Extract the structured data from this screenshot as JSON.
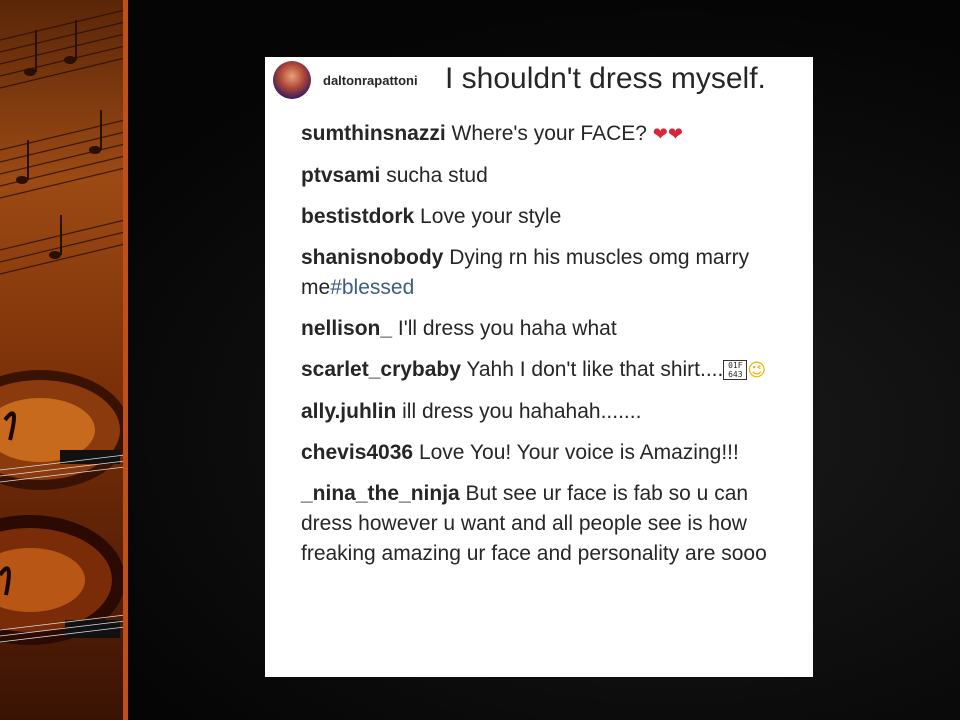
{
  "post": {
    "username": "daltonrapattoni",
    "caption": "I shouldn't dress myself."
  },
  "comments": [
    {
      "user": "sumthinsnazzi",
      "text": " Where's your FACE? ",
      "emoji": "❤❤"
    },
    {
      "user": "ptvsami",
      "text": " sucha stud"
    },
    {
      "user": "bestistdork",
      "text": " Love your style"
    },
    {
      "user": "shanisnobody",
      "text": " Dying rn his muscles omg marry me",
      "hashtag": "#blessed"
    },
    {
      "user": "nellison_",
      "text": " I'll dress you haha what"
    },
    {
      "user": "scarlet_crybaby",
      "text": " Yahh I don't like that shirt....",
      "box_glyph": "01F 643",
      "emoji": "😉"
    },
    {
      "user": "ally.juhlin",
      "text": " ill dress you hahahah......."
    },
    {
      "user": "chevis4036",
      "text": " Love You! Your voice is Amazing!!!"
    },
    {
      "user": "_nina_the_ninja",
      "text": " But see ur face is fab so u can dress however u want and all people see is how freaking amazing ur face and personality are sooo"
    }
  ],
  "colors": {
    "accent_strip": "#c0501a",
    "hashtag": "#3b5d84",
    "text": "#262626"
  }
}
